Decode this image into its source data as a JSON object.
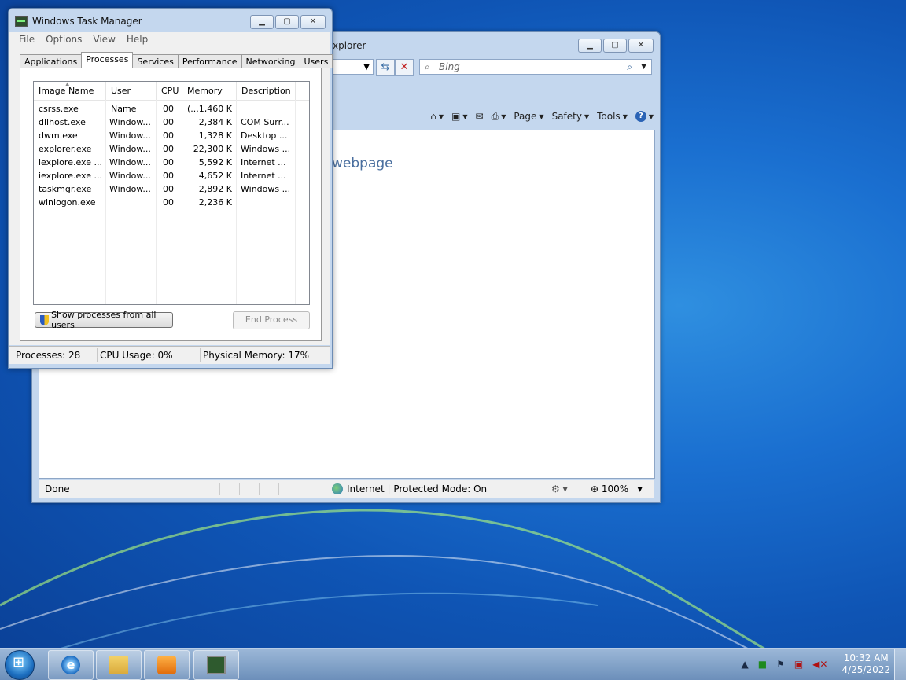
{
  "ie": {
    "title": "xplorer",
    "search_placeholder": "Bing",
    "commands": {
      "page": "Page",
      "safety": "Safety",
      "tools": "Tools"
    },
    "heading": "webpage",
    "status": {
      "done": "Done",
      "zone": "Internet | Protected Mode: On",
      "zoom": "100%"
    }
  },
  "taskmgr": {
    "title": "Windows Task Manager",
    "menu": [
      "File",
      "Options",
      "View",
      "Help"
    ],
    "tabs": [
      "Applications",
      "Processes",
      "Services",
      "Performance",
      "Networking",
      "Users"
    ],
    "active_tab": "Processes",
    "columns": [
      "Image Name",
      "User Name",
      "CPU",
      "Memory (...",
      "Description"
    ],
    "rows": [
      {
        "image": "csrss.exe",
        "user": "",
        "cpu": "00",
        "memory": "1,460 K",
        "description": ""
      },
      {
        "image": "dllhost.exe",
        "user": "Window...",
        "cpu": "00",
        "memory": "2,384 K",
        "description": "COM Surr..."
      },
      {
        "image": "dwm.exe",
        "user": "Window...",
        "cpu": "00",
        "memory": "1,328 K",
        "description": "Desktop ..."
      },
      {
        "image": "explorer.exe",
        "user": "Window...",
        "cpu": "00",
        "memory": "22,300 K",
        "description": "Windows ..."
      },
      {
        "image": "iexplore.exe ...",
        "user": "Window...",
        "cpu": "00",
        "memory": "5,592 K",
        "description": "Internet ..."
      },
      {
        "image": "iexplore.exe ...",
        "user": "Window...",
        "cpu": "00",
        "memory": "4,652 K",
        "description": "Internet ..."
      },
      {
        "image": "taskmgr.exe",
        "user": "Window...",
        "cpu": "00",
        "memory": "2,892 K",
        "description": "Windows ..."
      },
      {
        "image": "winlogon.exe",
        "user": "",
        "cpu": "00",
        "memory": "2,236 K",
        "description": ""
      }
    ],
    "show_all_label": "Show processes from all users",
    "end_process_label": "End Process",
    "status": {
      "processes": "Processes: 28",
      "cpu": "CPU Usage: 0%",
      "memory": "Physical Memory: 17%"
    }
  },
  "taskbar": {
    "clock_time": "10:32 AM",
    "clock_date": "4/25/2022"
  }
}
